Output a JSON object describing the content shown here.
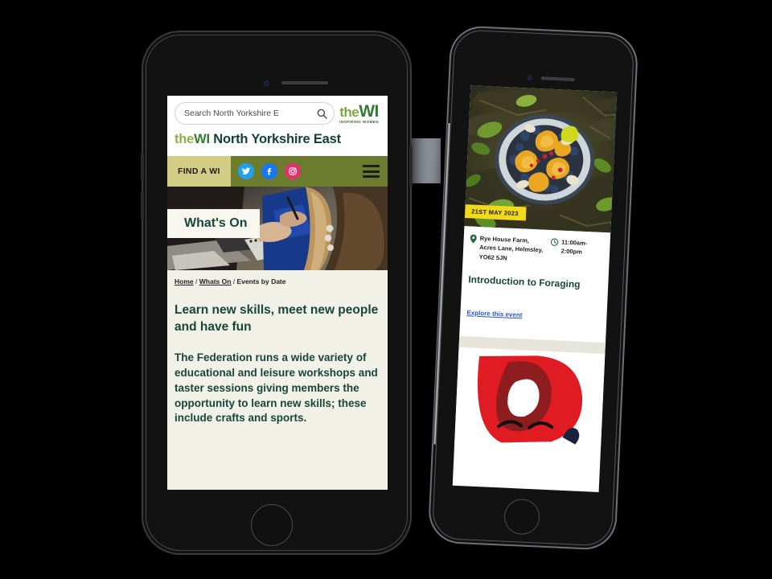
{
  "scene": {
    "background_color": "#000000",
    "description": "Two iPhone mockups showing a WI federation website on mobile"
  },
  "placeholder_block": {
    "color": "#8e929a"
  },
  "left_phone": {
    "device_name": "iphone-left",
    "site": {
      "search": {
        "placeholder": "Search North Yorkshire E",
        "value": "",
        "icon": "search-icon"
      },
      "logo": {
        "the": "the",
        "wi": "WI",
        "tagline": "INSPIRING WOMEN"
      },
      "federation_title": {
        "the": "the",
        "wi": "WI",
        "rest": " North Yorkshire East"
      },
      "nav": {
        "find_a_wi": "FIND A WI",
        "social": [
          {
            "name": "twitter-icon",
            "label": "Twitter",
            "color": "#1da1f2"
          },
          {
            "name": "facebook-icon",
            "label": "Facebook",
            "color": "#1877f2"
          },
          {
            "name": "instagram-icon",
            "label": "Instagram",
            "color": "#e1306c"
          }
        ],
        "menu": "hamburger-menu-icon",
        "bar_color": "#6b7c2e",
        "button_color": "#d2cc85"
      },
      "hero": {
        "label": "What's On",
        "image_alt": "people writing in notebooks at a workshop"
      },
      "breadcrumb": {
        "home": "Home",
        "whats_on": "Whats On",
        "current": "Events by Date",
        "separator": "/"
      },
      "heading": "Learn new skills, meet new people and have fun",
      "paragraph": "The Federation runs a wide variety of educational and leisure workshops and taster sessions giving members the opportunity to learn new skills; these include crafts and sports.",
      "text_color": "#17463b",
      "page_background": "#f2f1e8"
    }
  },
  "right_phone": {
    "device_name": "iphone-right",
    "event_card": {
      "image_alt": "bowl of chanterelle mushrooms and blueberries on forest floor",
      "date_badge": "21ST MAY 2023",
      "date_badge_color": "#f2d91c",
      "location_icon": "map-pin-icon",
      "location": "Rye House Farm, Acres Lane, Helmsley, YO62 5JN",
      "time_icon": "clock-icon",
      "time": "11:00am-2:00pm",
      "title": "Introduction to Foraging",
      "link": "Explore this event",
      "link_color": "#2f53d6"
    },
    "next_card": {
      "graphic": "red-abstract-logo-graphic",
      "color": "#e01b22"
    }
  }
}
